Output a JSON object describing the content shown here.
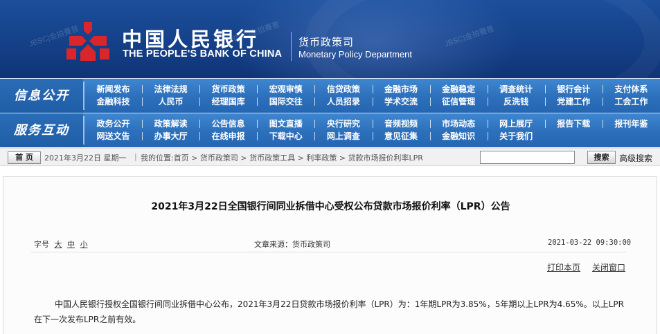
{
  "header": {
    "org_name_cn": "中国人民银行",
    "org_name_en": "THE PEOPLE'S BANK OF CHINA",
    "dept_cn": "货币政策司",
    "dept_en": "Monetary Policy Department",
    "watermark": "JBSC|金拍賽普"
  },
  "nav": {
    "row1": {
      "title": "信息公开",
      "items": [
        "新闻发布",
        "法律法规",
        "货币政策",
        "宏观审慎",
        "信贷政策",
        "金融市场",
        "金融稳定",
        "调查统计",
        "银行会计",
        "支付体系",
        "金融科技",
        "人民币",
        "经理国库",
        "国际交往",
        "人员招录",
        "学术交流",
        "征信管理",
        "反洗钱",
        "党建工作",
        "工会工作"
      ]
    },
    "row2": {
      "title": "服务互动",
      "items": [
        "政务公开",
        "政策解读",
        "公告信息",
        "图文直播",
        "央行研究",
        "音频视频",
        "市场动态",
        "网上展厅",
        "报告下载",
        "报刊年鉴",
        "网送文告",
        "办事大厅",
        "在线申报",
        "下载中心",
        "网上调查",
        "意见征集",
        "金融知识",
        "关于我们",
        "",
        ""
      ]
    }
  },
  "crumb": {
    "home_label": "首 页",
    "date_text": "2021年3月22日  星期一",
    "location_text": "我的位置:首页 > 货币政策司 > 货币政策工具 > 利率政策 > 贷款市场报价利率LPR",
    "search_value": "",
    "search_label": "搜索",
    "advanced_label": "高级搜索"
  },
  "article": {
    "title": "2021年3月22日全国银行间同业拆借中心受权公布贷款市场报价利率（LPR）公告",
    "font_size_label": "字号",
    "font_large": "大",
    "font_medium": "中",
    "font_small": "小",
    "source": "文章来源：货币政策司",
    "datetime": "2021-03-22  09:30:00",
    "print_label": "打印本页",
    "close_label": "关闭窗口",
    "body": "中国人民银行授权全国银行间同业拆借中心公布，2021年3月22日贷款市场报价利率（LPR）为：1年期LPR为3.85%，5年期以上LPR为4.65%。以上LPR在下一次发布LPR之前有效。"
  },
  "colors": {
    "header_blue": "#143f86",
    "nav_blue": "#2c6fbb",
    "emblem_red": "#d9262c"
  }
}
